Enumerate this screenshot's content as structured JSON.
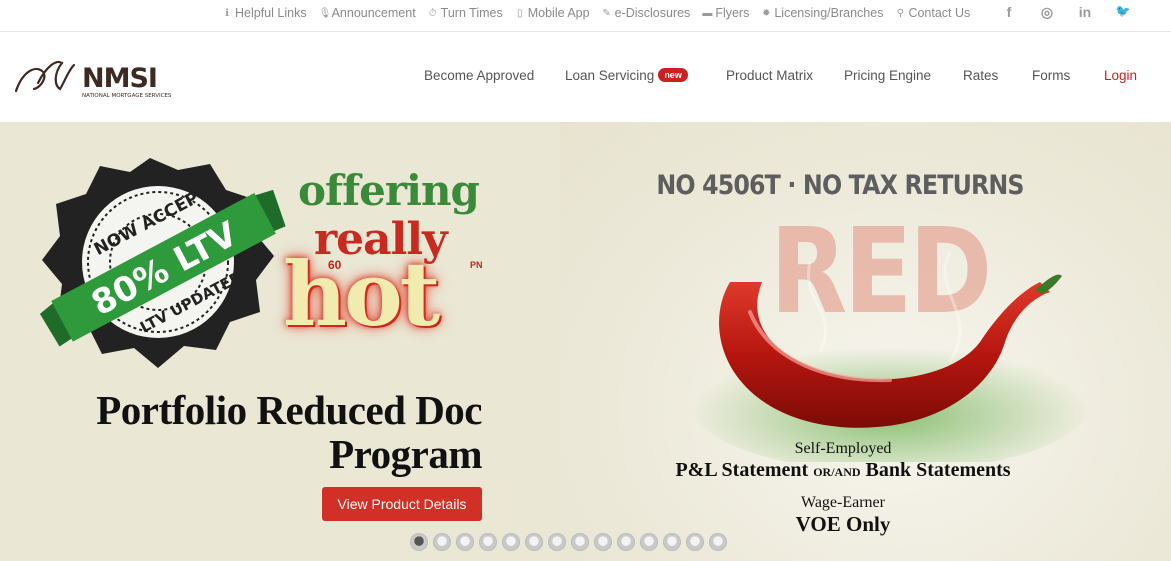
{
  "utility_links": [
    {
      "label": "Helpful Links",
      "icon": "info-icon"
    },
    {
      "label": "Announcement",
      "icon": "microphone-icon"
    },
    {
      "label": "Turn Times",
      "icon": "stopwatch-icon"
    },
    {
      "label": "Mobile App",
      "icon": "mobile-icon"
    },
    {
      "label": "e-Disclosures",
      "icon": "edit-icon"
    },
    {
      "label": "Flyers",
      "icon": "briefcase-icon"
    },
    {
      "label": "Licensing/Branches",
      "icon": "gear-icon"
    },
    {
      "label": "Contact Us",
      "icon": "map-marker-icon"
    }
  ],
  "social": [
    {
      "glyph": "f",
      "icon": "facebook-icon"
    },
    {
      "glyph": "◎",
      "icon": "instagram-icon"
    },
    {
      "glyph": "in",
      "icon": "linkedin-icon"
    },
    {
      "glyph": "🐦",
      "icon": "twitter-icon"
    }
  ],
  "logo": {
    "letters": "NMSI",
    "tagline": "NATIONAL MORTGAGE SERVICES"
  },
  "nav": {
    "become_approved": "Become Approved",
    "loan_servicing": "Loan Servicing",
    "loan_servicing_badge": "new",
    "product_matrix": "Product Matrix",
    "pricing_engine": "Pricing Engine",
    "rates": "Rates",
    "forms": "Forms",
    "login": "Login"
  },
  "hero": {
    "stamp_top": "NOW ACCEPT",
    "stamp_ribbon": "80% LTV",
    "stamp_bottom": "LTV UPDATED",
    "offering": "offering",
    "really": "really",
    "hot": "hot",
    "hot_small": "60",
    "hot_tm": "PN",
    "headline_line1": "Portfolio Reduced Doc",
    "headline_line2": "Program",
    "cta": "View Product Details",
    "no_tax": "NO 4506T · NO TAX RETURNS",
    "red_word": "RED",
    "self_employed": "Self-Employed",
    "pl_left": "P&L Statement ",
    "pl_or": "OR/AND",
    "pl_right": " Bank Statements",
    "wage_earner": "Wage-Earner",
    "voe": "VOE Only"
  },
  "carousel": {
    "count": 14,
    "active_index": 0
  },
  "colors": {
    "accent_red": "#cc1f1f",
    "green": "#3b8a3a",
    "hero_bg": "#eae7d5"
  }
}
